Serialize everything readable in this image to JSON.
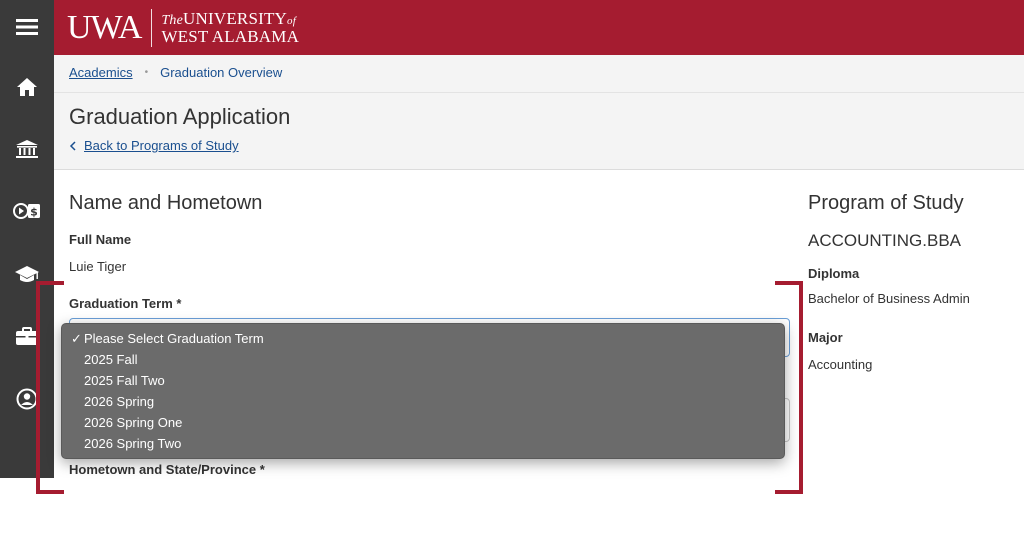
{
  "header": {
    "logo_mark": "UWA",
    "logo_line1_the": "The",
    "logo_line1": "UNIVERSITY",
    "logo_line1_of": "of",
    "logo_line2": "WEST ALABAMA",
    "brand_color": "#a51c30"
  },
  "sidebar": {
    "items": [
      {
        "icon": "menu-icon"
      },
      {
        "icon": "home-icon"
      },
      {
        "icon": "bank-icon"
      },
      {
        "icon": "finance-icon"
      },
      {
        "icon": "graduation-cap-icon"
      },
      {
        "icon": "briefcase-icon"
      },
      {
        "icon": "user-circle-icon"
      }
    ]
  },
  "breadcrumb": {
    "parent": "Academics",
    "separator": "•",
    "current": "Graduation Overview"
  },
  "page": {
    "title": "Graduation Application",
    "back_link": "Back to Programs of Study"
  },
  "form": {
    "section_title": "Name and Hometown",
    "full_name_label": "Full Name",
    "full_name_value": "Luie Tiger",
    "graduation_term_label": "Graduation Term *",
    "hometown_label": "Hometown and State/Province *"
  },
  "dropdown": {
    "selected_option": "Please Select Graduation Term",
    "options": [
      "Please Select Graduation Term",
      "2025 Fall",
      "2025 Fall Two",
      "2026 Spring",
      "2026 Spring One",
      "2026 Spring Two"
    ]
  },
  "program": {
    "section_title": "Program of Study",
    "program_code": "ACCOUNTING.BBA",
    "diploma_label": "Diploma",
    "diploma_value": "Bachelor of Business Admin",
    "major_label": "Major",
    "major_value": "Accounting"
  }
}
